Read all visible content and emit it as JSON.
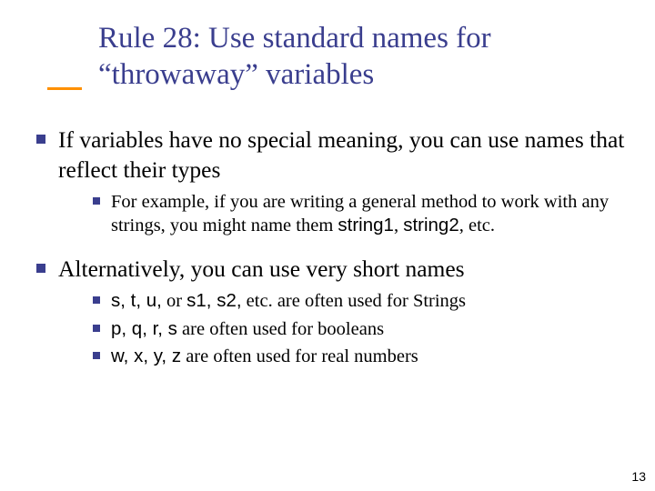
{
  "title": "Rule 28: Use standard names for “throwaway” variables",
  "bullets": {
    "p1": "If variables have no special meaning, you can use names that reflect their types",
    "p1_sub1_a": "For example, if you are writing a general method to work with any strings, you might name them ",
    "p1_sub1_code1": "string1",
    "p1_sub1_mid": ", ",
    "p1_sub1_code2": "string2",
    "p1_sub1_b": ", etc.",
    "p2": "Alternatively, you can use very short names",
    "p2_sub1_code": "s, t, u,",
    "p2_sub1_mid": " or ",
    "p2_sub1_code2": "s1, s2,",
    "p2_sub1_tail": " etc. are often used for Strings",
    "p2_sub2_code": "p, q, r, s",
    "p2_sub2_tail": " are often used for booleans",
    "p2_sub3_code": "w, x, y, z",
    "p2_sub3_tail": " are often used for real numbers"
  },
  "page_number": "13"
}
